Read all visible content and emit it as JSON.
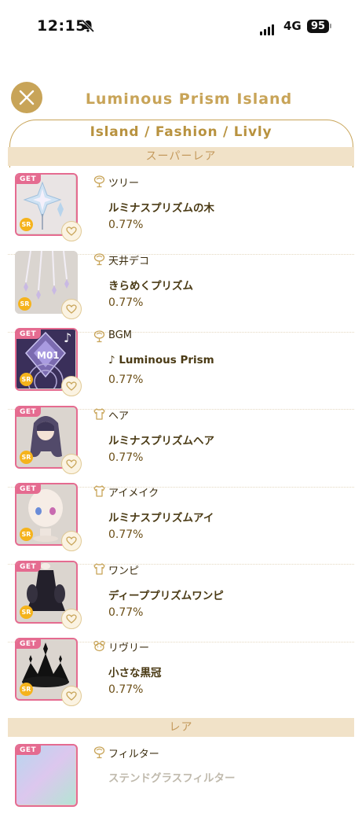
{
  "status_bar": {
    "time": "12:15",
    "network": "4G",
    "battery": "95"
  },
  "header": {
    "title": "Luminous Prism Island",
    "breadcrumb": "Island / Fashion / Livly"
  },
  "sections": {
    "super_rare": "スーパーレア",
    "rare": "レア"
  },
  "get_label": "GET",
  "sr_label": "SR",
  "items": [
    {
      "category": "ツリー",
      "icon": "tree-icon",
      "name": "ルミナスプリズムの木",
      "rate": "0.77%",
      "obtained": true
    },
    {
      "category": "天井デコ",
      "icon": "tree-icon",
      "name": "きらめくプリズム",
      "rate": "0.77%",
      "obtained": false
    },
    {
      "category": "BGM",
      "icon": "tree-icon",
      "name": "♪ Luminous Prism",
      "rate": "0.77%",
      "obtained": true,
      "thumb_text": "M01"
    },
    {
      "category": "ヘア",
      "icon": "shirt-icon",
      "name": "ルミナスプリズムヘア",
      "rate": "0.77%",
      "obtained": true
    },
    {
      "category": "アイメイク",
      "icon": "shirt-icon",
      "name": "ルミナスプリズムアイ",
      "rate": "0.77%",
      "obtained": true
    },
    {
      "category": "ワンピ",
      "icon": "shirt-icon",
      "name": "ディーププリズムワンピ",
      "rate": "0.77%",
      "obtained": true
    },
    {
      "category": "リヴリー",
      "icon": "livly-icon",
      "name": "小さな黒冠",
      "rate": "0.77%",
      "obtained": true
    }
  ],
  "rare_items": [
    {
      "category": "フィルター",
      "icon": "tree-icon",
      "name": "ステンドグラスフィルター",
      "obtained": true
    }
  ],
  "colors": {
    "accent": "#c8a458",
    "get_pink": "#e56b90",
    "sr_gold": "#f5b31c",
    "section_bg": "#f1e2c8"
  }
}
